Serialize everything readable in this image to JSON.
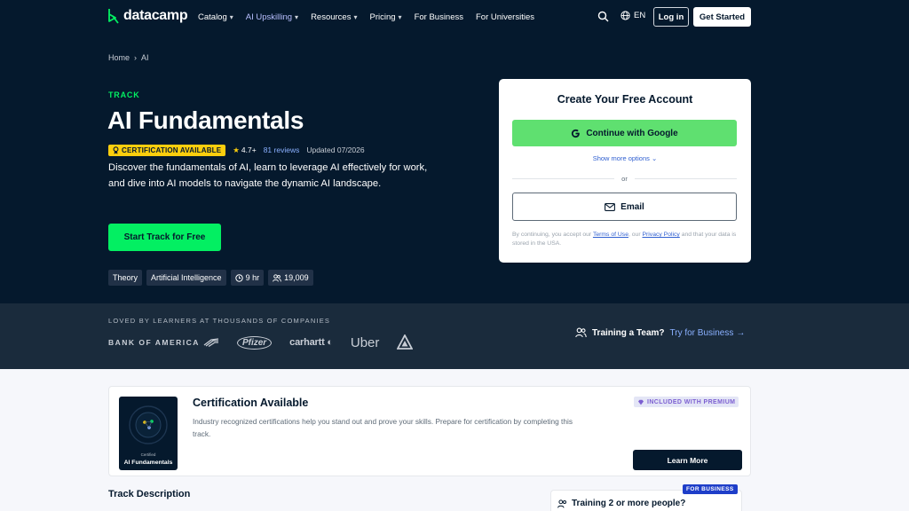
{
  "colors": {
    "hero_bg": "#05192d",
    "accent_green": "#03ef62",
    "badge_yellow": "#fcce0d",
    "link_blue": "#8ab0ff"
  },
  "nav": {
    "logo_text": "datacamp",
    "links": [
      {
        "label": "Catalog",
        "has_dropdown": true
      },
      {
        "label": "AI Upskilling",
        "has_dropdown": true
      },
      {
        "label": "Resources",
        "has_dropdown": true
      },
      {
        "label": "Pricing",
        "has_dropdown": true
      },
      {
        "label": "For Business",
        "has_dropdown": false
      },
      {
        "label": "For Universities",
        "has_dropdown": false
      }
    ],
    "language": "EN",
    "login_label": "Log in",
    "get_started_label": "Get Started"
  },
  "breadcrumb": {
    "home": "Home",
    "separator": "›",
    "current": "AI"
  },
  "hero": {
    "kicker": "TRACK",
    "title": "AI Fundamentals",
    "cert_badge": "CERTIFICATION AVAILABLE",
    "rating": "4.7+",
    "reviews": "81 reviews",
    "updated": "Updated 07/2026",
    "description": "Discover the fundamentals of AI, learn to leverage AI effectively for work, and dive into AI models to navigate the dynamic AI landscape.",
    "cta_label": "Start Track for Free",
    "tags": [
      {
        "label": "Theory",
        "icon": ""
      },
      {
        "label": "Artificial Intelligence",
        "icon": ""
      },
      {
        "label": "9 hr",
        "icon": "clock-icon"
      },
      {
        "label": "19,009",
        "icon": "users-icon"
      }
    ]
  },
  "signup": {
    "title": "Create Your Free Account",
    "google_label": "Continue with Google",
    "more_options": "Show more options",
    "or": "or",
    "email_label": "Email",
    "legal_prefix": "By continuing, you accept our",
    "terms_link": "Terms of Use",
    "legal_mid": ", our",
    "privacy_link": "Privacy Policy",
    "legal_suffix": "and that your data is stored in the USA."
  },
  "companies": {
    "heading": "LOVED BY LEARNERS AT THOUSANDS OF COMPANIES",
    "logos": [
      "BANK OF AMERICA",
      "Pfizer",
      "carhartt",
      "Uber"
    ]
  },
  "training_team": {
    "label": "Training a Team?",
    "link": "Try for Business"
  },
  "certification": {
    "image_subtitle": "Certified",
    "image_title": "AI Fundamentals",
    "title": "Certification Available",
    "description": "Industry recognized certifications help you stand out and prove your skills. Prepare for certification by completing this track.",
    "premium_badge": "INCLUDED WITH PREMIUM",
    "cta_label": "Learn More"
  },
  "track_description_heading": "Track Description",
  "business_card": {
    "badge": "FOR BUSINESS",
    "title": "Training 2 or more people?"
  }
}
